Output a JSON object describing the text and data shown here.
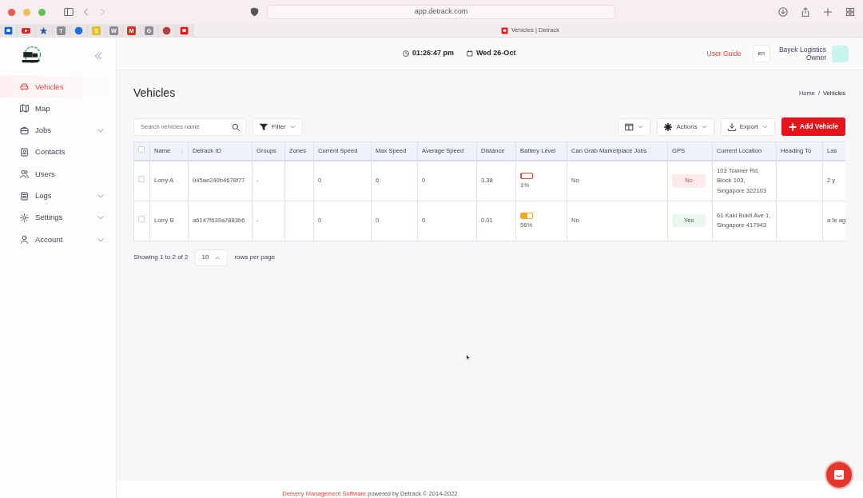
{
  "browser": {
    "url": "app.detrack.com",
    "tab_title": "Vehicles | Detrack",
    "bookmarks": [
      {
        "kind": "box",
        "color": "#1565c0"
      },
      {
        "kind": "play",
        "color": "#e62117"
      },
      {
        "kind": "star",
        "color": "#2a5db0"
      },
      {
        "kind": "letter",
        "label": "T",
        "color": "#8a8d93"
      },
      {
        "kind": "circle",
        "color": "#1e6fd9"
      },
      {
        "kind": "letter",
        "label": "S",
        "color": "#e8c21a"
      },
      {
        "kind": "letter",
        "label": "W",
        "color": "#8a8d93"
      },
      {
        "kind": "letter",
        "label": "M",
        "color": "#d93025"
      },
      {
        "kind": "letter",
        "label": "G",
        "color": "#8a8d93"
      },
      {
        "kind": "circle",
        "color": "#b0413e"
      },
      {
        "kind": "box",
        "color": "#e01b24"
      }
    ]
  },
  "sidebar": {
    "items": [
      {
        "label": "Vehicles",
        "selected": true,
        "expandable": false
      },
      {
        "label": "Map",
        "selected": false,
        "expandable": false
      },
      {
        "label": "Jobs",
        "selected": false,
        "expandable": true
      },
      {
        "label": "Contacts",
        "selected": false,
        "expandable": false
      },
      {
        "label": "Users",
        "selected": false,
        "expandable": false
      },
      {
        "label": "Logs",
        "selected": false,
        "expandable": true
      },
      {
        "label": "Settings",
        "selected": false,
        "expandable": true
      },
      {
        "label": "Account",
        "selected": false,
        "expandable": true
      }
    ]
  },
  "header": {
    "time": "01:26:47 pm",
    "date": "Wed 26-Oct",
    "user_guide": "User Guide",
    "language": "en",
    "company": "Bayek Logistics",
    "role": "Owner"
  },
  "page": {
    "title": "Vehicles",
    "breadcrumb": [
      "Home",
      "Vehicles"
    ],
    "breadcrumb_separator": "/"
  },
  "toolbar": {
    "search_placeholder": "Search vehicles name",
    "filter": "Filter",
    "actions": "Actions",
    "export": "Export",
    "add": "Add Vehicle"
  },
  "table": {
    "columns": [
      "Name",
      "Detrack ID",
      "Groups",
      "Zones",
      "Current Speed",
      "Max Speed",
      "Average Speed",
      "Distance",
      "Battery Level",
      "Can Grab Marketplace Jobs",
      "GPS",
      "Current Location",
      "Heading To",
      "Las"
    ],
    "all_checked": false,
    "rows": [
      {
        "checked": false,
        "name": "Lorry A",
        "id": "945ae240b4678f77",
        "groups": "-",
        "zones": "",
        "current_speed": "0",
        "max_speed": "6",
        "average_speed": "0",
        "distance": "3.38",
        "battery": {
          "level": 0.01,
          "reading": "1%"
        },
        "marketplace": "No",
        "gps": {
          "label": "No",
          "on": false
        },
        "location": "103 Towner Rd, Block 103, Singapore 322103",
        "heading": "",
        "last": "2 y"
      },
      {
        "checked": false,
        "name": "Lorry B",
        "id": "a6147f639a7883b6",
        "groups": "-",
        "zones": "",
        "current_speed": "0",
        "max_speed": "0",
        "average_speed": "0",
        "distance": "0.01",
        "battery": {
          "level": 0.56,
          "reading": "56%"
        },
        "marketplace": "No",
        "gps": {
          "label": "Yes",
          "on": true
        },
        "location": "61 Kaki Bukit Ave 1, Singapore 417943",
        "heading": "",
        "last": "a fe ag"
      }
    ]
  },
  "pagination": {
    "summary": "Showing 1 to 2 of 2",
    "per_page": "10",
    "suffix": "rows per page"
  },
  "footer": {
    "link": "Delivery Management Software",
    "text": "powered by Detrack © 2014-2022"
  }
}
